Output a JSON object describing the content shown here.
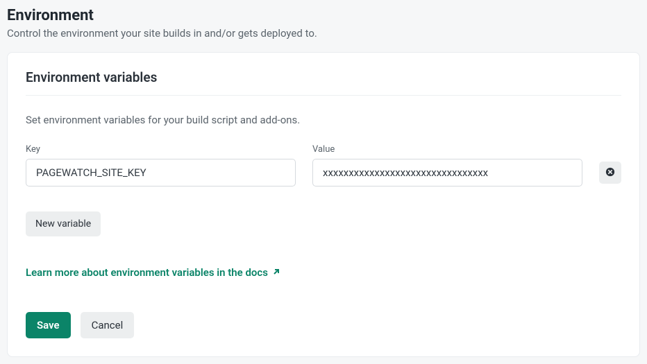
{
  "header": {
    "title": "Environment",
    "subtitle": "Control the environment your site builds in and/or gets deployed to."
  },
  "section": {
    "title": "Environment variables",
    "description": "Set environment variables for your build script and add-ons."
  },
  "labels": {
    "key": "Key",
    "value": "Value"
  },
  "variables": [
    {
      "key": "PAGEWATCH_SITE_KEY",
      "value": "xxxxxxxxxxxxxxxxxxxxxxxxxxxxxxxx"
    }
  ],
  "buttons": {
    "new_variable": "New variable",
    "save": "Save",
    "cancel": "Cancel"
  },
  "link": {
    "docs": "Learn more about environment variables in the docs"
  }
}
